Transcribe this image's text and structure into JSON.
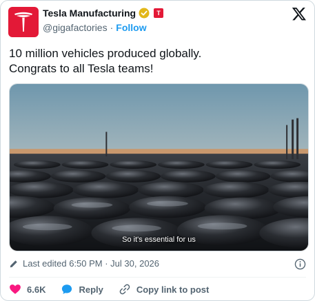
{
  "author": {
    "display_name": "Tesla Manufacturing",
    "handle": "@gigafactories",
    "separator": "·",
    "follow_label": "Follow",
    "affiliate_badge": "T"
  },
  "tweet": {
    "text": "10 million vehicles produced globally.\nCongrats to all Tesla teams!"
  },
  "media": {
    "caption": "So it's essential for us"
  },
  "meta": {
    "edited_label": "Last edited 6:50 PM · Jul 30, 2026"
  },
  "actions": {
    "like_count": "6.6K",
    "reply_label": "Reply",
    "copy_link_label": "Copy link to post"
  },
  "colors": {
    "brand_red": "#e31937",
    "link_blue": "#1d9bf0",
    "like_pink": "#f91880",
    "verified_gold": "#e2b719",
    "muted_text": "#536471"
  },
  "icons": [
    "tesla-logo-icon",
    "verified-badge-icon",
    "x-logo-icon",
    "pencil-icon",
    "info-icon",
    "heart-icon",
    "reply-bubble-icon",
    "link-icon"
  ]
}
